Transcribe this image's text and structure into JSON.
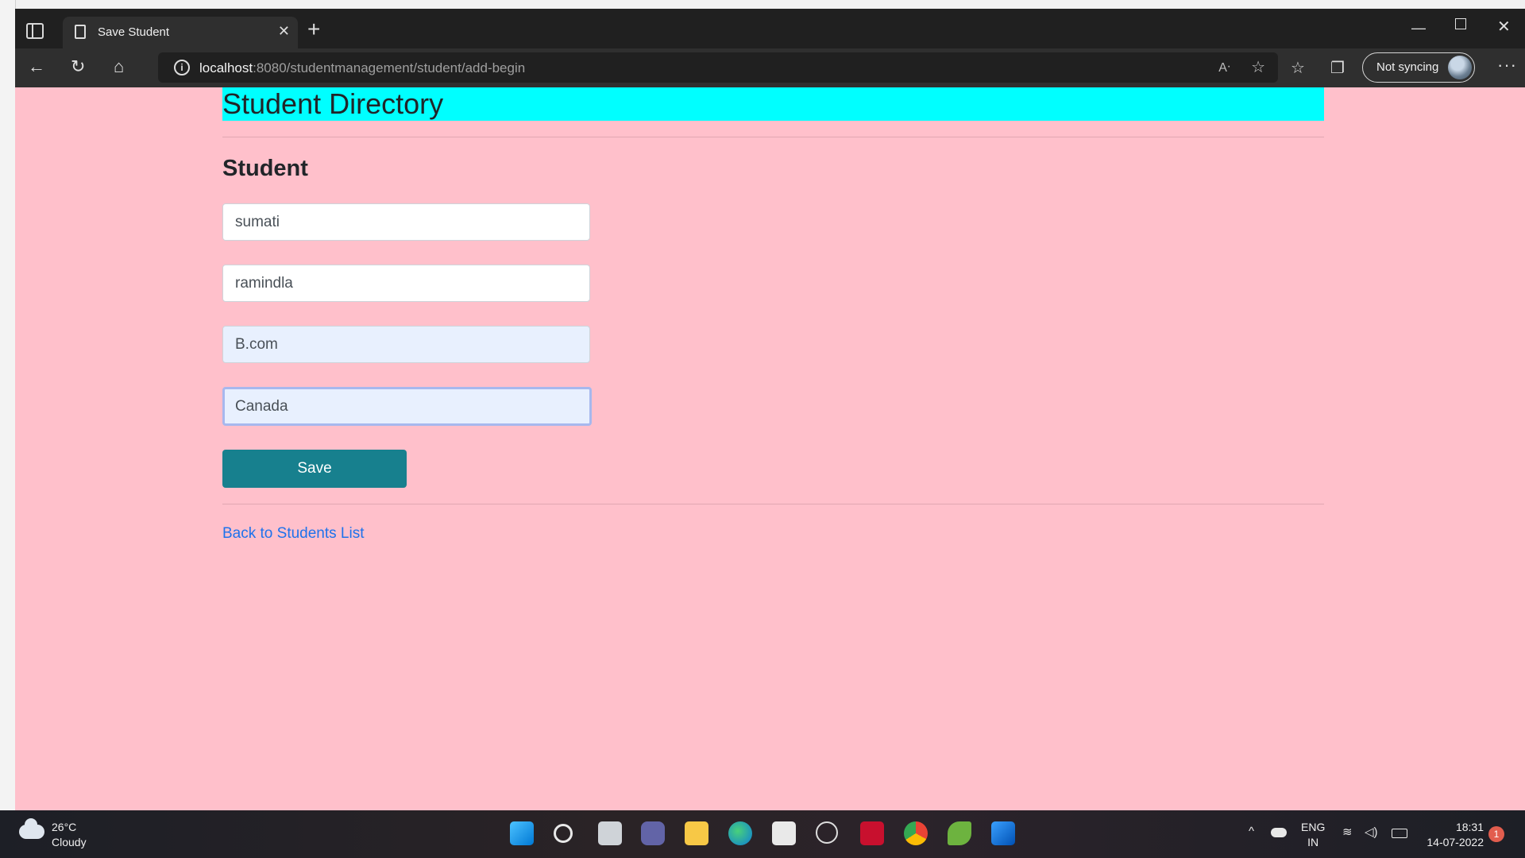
{
  "browser": {
    "tab_title": "Save Student",
    "url_host": "localhost",
    "url_path": ":8080/studentmanagement/student/add-begin",
    "profile_label": "Not syncing"
  },
  "page": {
    "banner_title": "Student Directory",
    "section_title": "Student",
    "fields": [
      {
        "value": "sumati",
        "state": "default"
      },
      {
        "value": "ramindla",
        "state": "default"
      },
      {
        "value": "B.com",
        "state": "autofilled"
      },
      {
        "value": "Canada",
        "state": "focused"
      }
    ],
    "save_label": "Save",
    "back_link": "Back to Students List",
    "colors": {
      "page_bg": "#ffc0cb",
      "banner_bg": "#00ffff",
      "save_bg": "#17808e",
      "link": "#1e72ec"
    }
  },
  "taskbar": {
    "temperature": "26°C",
    "condition": "Cloudy",
    "lang_primary": "ENG",
    "lang_secondary": "IN",
    "time": "18:31",
    "date": "14-07-2022",
    "notification_count": "1",
    "apps": [
      "windows-start-icon",
      "search-icon",
      "task-view-icon",
      "teams-chat-icon",
      "file-explorer-icon",
      "edge-icon",
      "store-icon",
      "dell-icon",
      "mcafee-icon",
      "chrome-icon",
      "spring-tools-icon",
      "photos-icon"
    ]
  }
}
